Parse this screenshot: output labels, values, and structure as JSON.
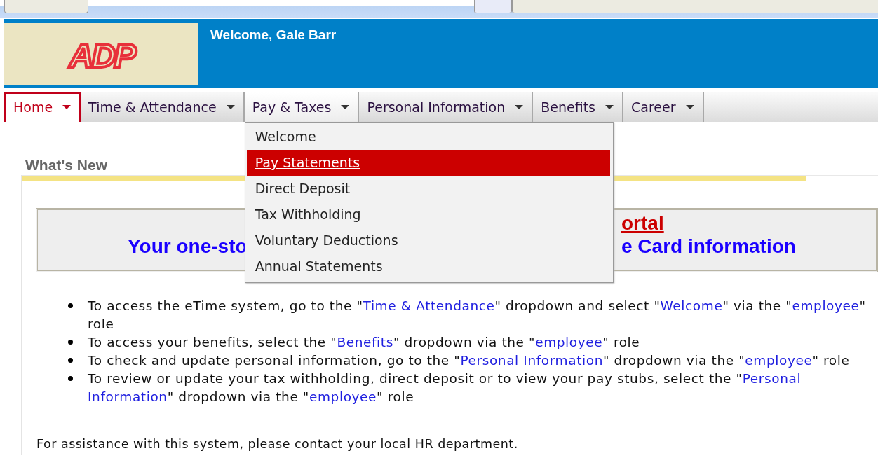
{
  "header": {
    "logo_text": "ADP",
    "welcome": "Welcome, Gale Barr"
  },
  "nav": [
    {
      "label": "Home",
      "selected": true,
      "expanded": false
    },
    {
      "label": "Time & Attendance",
      "selected": false,
      "expanded": false
    },
    {
      "label": "Pay & Taxes",
      "selected": false,
      "expanded": true,
      "menu": [
        {
          "label": "Welcome",
          "selected": false
        },
        {
          "label": "Pay Statements",
          "selected": true
        },
        {
          "label": "Direct Deposit",
          "selected": false
        },
        {
          "label": "Tax Withholding",
          "selected": false
        },
        {
          "label": "Voluntary Deductions",
          "selected": false
        },
        {
          "label": "Annual Statements",
          "selected": false
        }
      ]
    },
    {
      "label": "Personal Information",
      "selected": false,
      "expanded": false
    },
    {
      "label": "Benefits",
      "selected": false,
      "expanded": false
    },
    {
      "label": "Career",
      "selected": false,
      "expanded": false
    }
  ],
  "section_title": "What's New",
  "banner": {
    "line_1": "ortal",
    "line_2_left": "Your one-sto",
    "line_2_right": "e Card information"
  },
  "bullets": [
    {
      "segments": [
        {
          "text": "To access the eTime system, go to the \"",
          "kind": "plain"
        },
        {
          "text": "Time & Attendance",
          "kind": "term"
        },
        {
          "text": "\" dropdown and select \"",
          "kind": "plain"
        },
        {
          "text": "Welcome",
          "kind": "term"
        },
        {
          "text": "\" via the \"",
          "kind": "plain"
        },
        {
          "text": "employee",
          "kind": "term"
        },
        {
          "text": "\" role",
          "kind": "plain"
        }
      ]
    },
    {
      "segments": [
        {
          "text": "To access your benefits, select the \"",
          "kind": "plain"
        },
        {
          "text": "Benefits",
          "kind": "term"
        },
        {
          "text": "\" dropdown via the \"",
          "kind": "plain"
        },
        {
          "text": "employee",
          "kind": "term"
        },
        {
          "text": "\" role",
          "kind": "plain"
        }
      ]
    },
    {
      "segments": [
        {
          "text": "To check and update personal information, go to the \"",
          "kind": "plain"
        },
        {
          "text": "Personal Information",
          "kind": "term"
        },
        {
          "text": "\" dropdown via the \"",
          "kind": "plain"
        },
        {
          "text": "employee",
          "kind": "term"
        },
        {
          "text": "\" role",
          "kind": "plain"
        }
      ]
    },
    {
      "segments": [
        {
          "text": "To review or update your tax withholding, direct deposit or to view your pay stubs, select the \"",
          "kind": "plain"
        },
        {
          "text": "Personal Information",
          "kind": "term"
        },
        {
          "text": "\" dropdown via the \"",
          "kind": "plain"
        },
        {
          "text": "employee",
          "kind": "term"
        },
        {
          "text": "\" role",
          "kind": "plain"
        }
      ]
    }
  ],
  "footer": "For assistance with this system, please contact your local HR department."
}
